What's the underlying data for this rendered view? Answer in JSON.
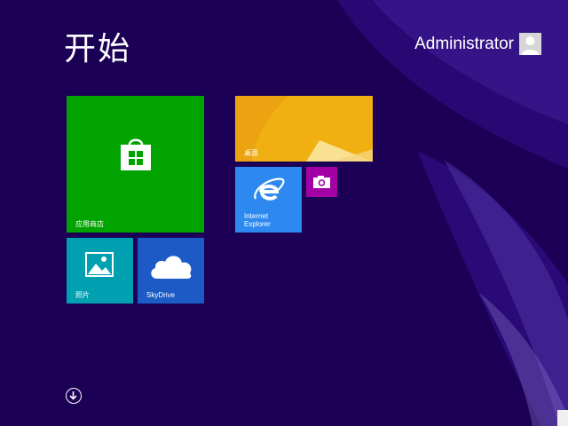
{
  "screen": {
    "title": "开始"
  },
  "user": {
    "name": "Administrator"
  },
  "tiles": {
    "store": {
      "label": "应用商店",
      "color": "#00a300"
    },
    "desktop": {
      "label": "桌面",
      "color": "#f0b012"
    },
    "ie": {
      "label": "Internet Explorer",
      "color": "#2d89ef"
    },
    "camera": {
      "color": "#a200a4"
    },
    "photos": {
      "label": "照片",
      "color": "#00a0b1"
    },
    "skydrive": {
      "label": "SkyDrive",
      "color": "#1c5bc6"
    }
  },
  "icons": {
    "store": "shopping-bag-windows-icon",
    "camera": "camera-icon",
    "ie": "internet-explorer-icon",
    "photos": "picture-icon",
    "skydrive": "cloud-icon",
    "all_apps": "down-arrow-circle-icon",
    "avatar": "user-silhouette-icon"
  }
}
